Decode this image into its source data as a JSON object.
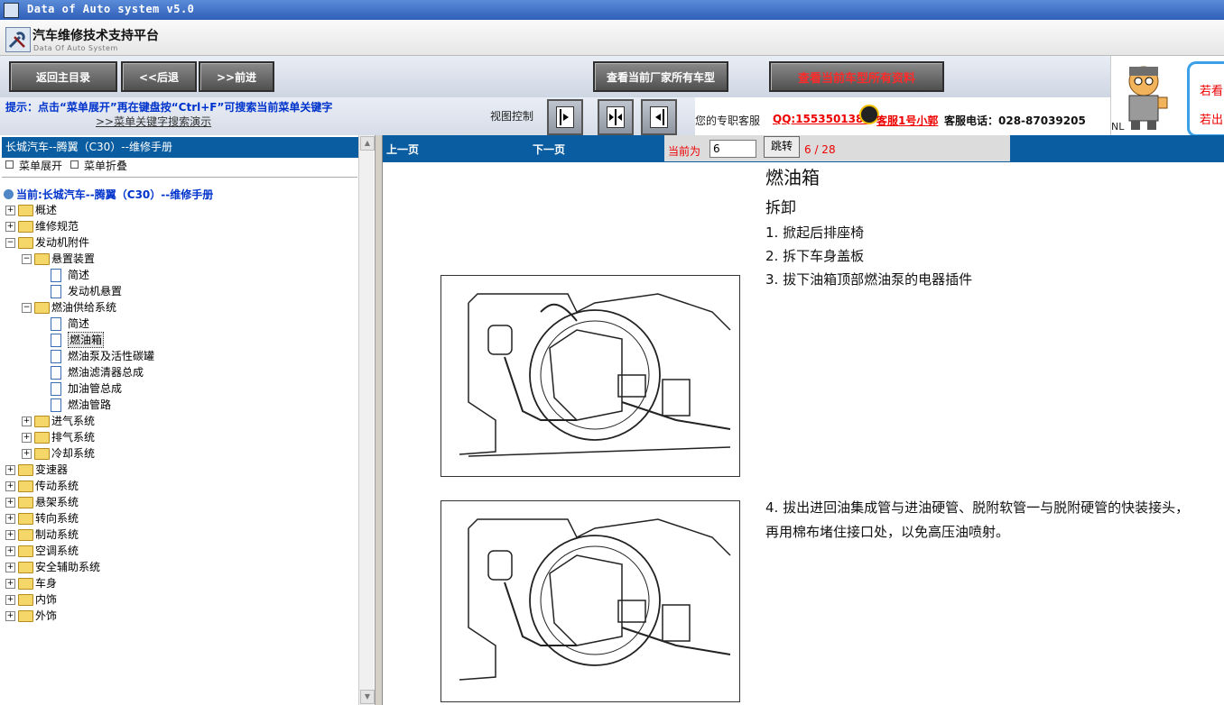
{
  "window": {
    "title": "Data of Auto system v5.0"
  },
  "app": {
    "title_zh": "汽车维修技术支持平台",
    "title_en": "Data Of Auto System"
  },
  "toolbar": {
    "home": "返回主目录",
    "back": "<<后退",
    "forward": ">>前进",
    "all_models": "查看当前厂家所有车型",
    "all_docs": "查看当前车型所有资料"
  },
  "hint": {
    "text": "提示：点击“菜单展开”再在键盘按“Ctrl+F”可搜索当前菜单关键字",
    "demo_link": ">>菜单关键字搜索演示",
    "view_label": "视图控制"
  },
  "service": {
    "label": "您的专职客服",
    "qq": "QQ:1553501388",
    "agent": "客服1号小郭",
    "phone": "客服电话：028-87039205"
  },
  "promo": {
    "line1": "若看",
    "line2": "若出",
    "footer": "NL"
  },
  "sidebar": {
    "breadcrumb": "长城汽车--腾翼（C30）--维修手册",
    "expand": "菜单展开",
    "collapse": "菜单折叠",
    "current": "当前:长城汽车--腾翼（C30）--维修手册",
    "tree": [
      {
        "label": "概述",
        "level": 0,
        "type": "folder",
        "open": false
      },
      {
        "label": "维修规范",
        "level": 0,
        "type": "folder",
        "open": false
      },
      {
        "label": "发动机附件",
        "level": 0,
        "type": "folder",
        "open": true
      },
      {
        "label": "悬置装置",
        "level": 1,
        "type": "folder",
        "open": true
      },
      {
        "label": "简述",
        "level": 2,
        "type": "doc"
      },
      {
        "label": "发动机悬置",
        "level": 2,
        "type": "doc"
      },
      {
        "label": "燃油供给系统",
        "level": 1,
        "type": "folder",
        "open": true
      },
      {
        "label": "简述",
        "level": 2,
        "type": "doc"
      },
      {
        "label": "燃油箱",
        "level": 2,
        "type": "doc",
        "selected": true
      },
      {
        "label": "燃油泵及活性碳罐",
        "level": 2,
        "type": "doc"
      },
      {
        "label": "燃油滤清器总成",
        "level": 2,
        "type": "doc"
      },
      {
        "label": "加油管总成",
        "level": 2,
        "type": "doc"
      },
      {
        "label": "燃油管路",
        "level": 2,
        "type": "doc"
      },
      {
        "label": "进气系统",
        "level": 1,
        "type": "folder",
        "open": false
      },
      {
        "label": "排气系统",
        "level": 1,
        "type": "folder",
        "open": false
      },
      {
        "label": "冷却系统",
        "level": 1,
        "type": "folder",
        "open": false
      },
      {
        "label": "变速器",
        "level": 0,
        "type": "folder",
        "open": false
      },
      {
        "label": "传动系统",
        "level": 0,
        "type": "folder",
        "open": false
      },
      {
        "label": "悬架系统",
        "level": 0,
        "type": "folder",
        "open": false
      },
      {
        "label": "转向系统",
        "level": 0,
        "type": "folder",
        "open": false
      },
      {
        "label": "制动系统",
        "level": 0,
        "type": "folder",
        "open": false
      },
      {
        "label": "空调系统",
        "level": 0,
        "type": "folder",
        "open": false
      },
      {
        "label": "安全辅助系统",
        "level": 0,
        "type": "folder",
        "open": false
      },
      {
        "label": "车身",
        "level": 0,
        "type": "folder",
        "open": false
      },
      {
        "label": "内饰",
        "level": 0,
        "type": "folder",
        "open": false
      },
      {
        "label": "外饰",
        "level": 0,
        "type": "folder",
        "open": false
      }
    ]
  },
  "pager": {
    "prev": "上一页",
    "next": "下一页",
    "current_label": "当前为",
    "current_value": "6",
    "jump": "跳转",
    "count": "6 / 28"
  },
  "document": {
    "title": "燃油箱",
    "section": "拆卸",
    "steps": [
      "1.  掀起后排座椅",
      "2.  拆下车身盖板",
      "3.  拔下油箱顶部燃油泵的电器插件"
    ],
    "step4": "4.  拔出进回油集成管与进油硬管、脱附软管一与脱附硬管的快装接头，再用棉布堵住接口处，以免高压油喷射。"
  },
  "icons": {
    "view_buttons": [
      "view-right-icon",
      "view-split-icon",
      "view-left-icon"
    ],
    "qq_icon": "qq-penguin-icon"
  }
}
